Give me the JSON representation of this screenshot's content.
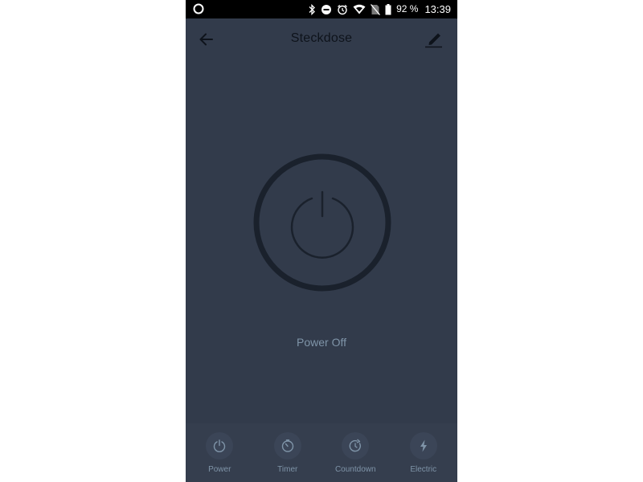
{
  "status_bar": {
    "battery_percent": "92 %",
    "time": "13:39",
    "icons": [
      "circle-app-icon",
      "bluetooth-icon",
      "do-not-disturb-icon",
      "alarm-icon",
      "wifi-icon",
      "no-sim-icon",
      "battery-icon"
    ]
  },
  "header": {
    "title": "Steckdose",
    "back_icon": "arrow-left-icon",
    "edit_icon": "pencil-icon"
  },
  "device": {
    "power_icon": "power-icon",
    "status_text": "Power Off",
    "is_on": false
  },
  "tabs": [
    {
      "label": "Power",
      "icon": "power-icon"
    },
    {
      "label": "Timer",
      "icon": "timer-icon"
    },
    {
      "label": "Countdown",
      "icon": "countdown-icon"
    },
    {
      "label": "Electric",
      "icon": "lightning-icon"
    }
  ],
  "colors": {
    "background": "#323b4b",
    "tab_bar": "#353e4e",
    "muted_text": "#7f94a8",
    "dark_icon": "#1a212c",
    "status_bar": "#000000"
  }
}
